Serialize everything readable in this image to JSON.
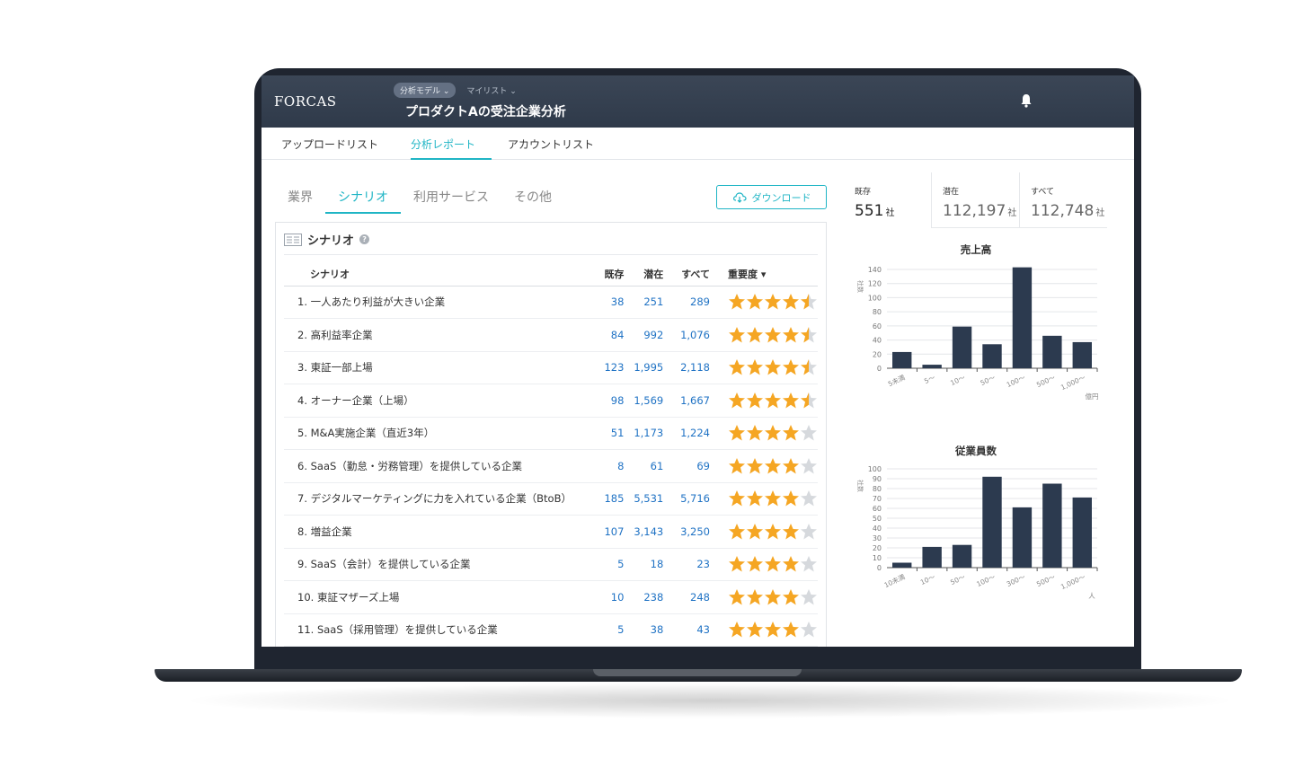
{
  "header": {
    "logo": "FORCAS",
    "crumbs": [
      "分析モデル ⌄",
      "マイリスト ⌄"
    ],
    "title": "プロダクトAの受注企業分析"
  },
  "subnav": [
    "アップロードリスト",
    "分析レポート",
    "アカウントリスト"
  ],
  "tabs": [
    "業界",
    "シナリオ",
    "利用サービス",
    "その他"
  ],
  "download_label": "ダウンロード",
  "card_title": "シナリオ",
  "table": {
    "headers": [
      "シナリオ",
      "既存",
      "潜在",
      "すべて",
      "重要度 ▾"
    ],
    "rows": [
      {
        "name": "1. 一人あたり利益が大きい企業",
        "existing": "38",
        "potential": "251",
        "all": "289",
        "rating": 4.5
      },
      {
        "name": "2. 高利益率企業",
        "existing": "84",
        "potential": "992",
        "all": "1,076",
        "rating": 4.5
      },
      {
        "name": "3. 東証一部上場",
        "existing": "123",
        "potential": "1,995",
        "all": "2,118",
        "rating": 4.5
      },
      {
        "name": "4. オーナー企業（上場）",
        "existing": "98",
        "potential": "1,569",
        "all": "1,667",
        "rating": 4.5
      },
      {
        "name": "5. M&A実施企業（直近3年）",
        "existing": "51",
        "potential": "1,173",
        "all": "1,224",
        "rating": 4
      },
      {
        "name": "6. SaaS（勤怠・労務管理）を提供している企業",
        "existing": "8",
        "potential": "61",
        "all": "69",
        "rating": 4
      },
      {
        "name": "7. デジタルマーケティングに力を入れている企業（BtoB）",
        "existing": "185",
        "potential": "5,531",
        "all": "5,716",
        "rating": 4
      },
      {
        "name": "8. 増益企業",
        "existing": "107",
        "potential": "3,143",
        "all": "3,250",
        "rating": 4
      },
      {
        "name": "9. SaaS（会計）を提供している企業",
        "existing": "5",
        "potential": "18",
        "all": "23",
        "rating": 4
      },
      {
        "name": "10. 東証マザーズ上場",
        "existing": "10",
        "potential": "238",
        "all": "248",
        "rating": 4
      },
      {
        "name": "11. SaaS（採用管理）を提供している企業",
        "existing": "5",
        "potential": "38",
        "all": "43",
        "rating": 4
      }
    ]
  },
  "stats": [
    {
      "label": "既存",
      "value": "551",
      "unit": "社"
    },
    {
      "label": "潜在",
      "value": "112,197",
      "unit": "社"
    },
    {
      "label": "すべて",
      "value": "112,748",
      "unit": "社"
    }
  ],
  "colors": {
    "accent": "#1fb5c5",
    "link": "#1f72c4",
    "bar": "#2c3a4f",
    "star": "#f5a623",
    "star_empty": "#d6d9dd"
  },
  "chart_data": [
    {
      "type": "bar",
      "title": "売上高",
      "ylabel": "社数",
      "xunit": "億円",
      "categories": [
        "5未満",
        "5〜",
        "10〜",
        "50〜",
        "100〜",
        "500〜",
        "1,000〜"
      ],
      "values": [
        23,
        5,
        59,
        34,
        143,
        46,
        37
      ],
      "ylim": [
        0,
        140
      ],
      "yticks": [
        0,
        20,
        40,
        60,
        80,
        100,
        120,
        140
      ]
    },
    {
      "type": "bar",
      "title": "従業員数",
      "ylabel": "社数",
      "xunit": "人",
      "categories": [
        "10未満",
        "10〜",
        "50〜",
        "100〜",
        "300〜",
        "500〜",
        "1,000〜"
      ],
      "values": [
        5,
        21,
        23,
        92,
        61,
        85,
        71
      ],
      "ylim": [
        0,
        100
      ],
      "yticks": [
        0,
        10,
        20,
        30,
        40,
        50,
        60,
        70,
        80,
        90,
        100
      ]
    }
  ]
}
